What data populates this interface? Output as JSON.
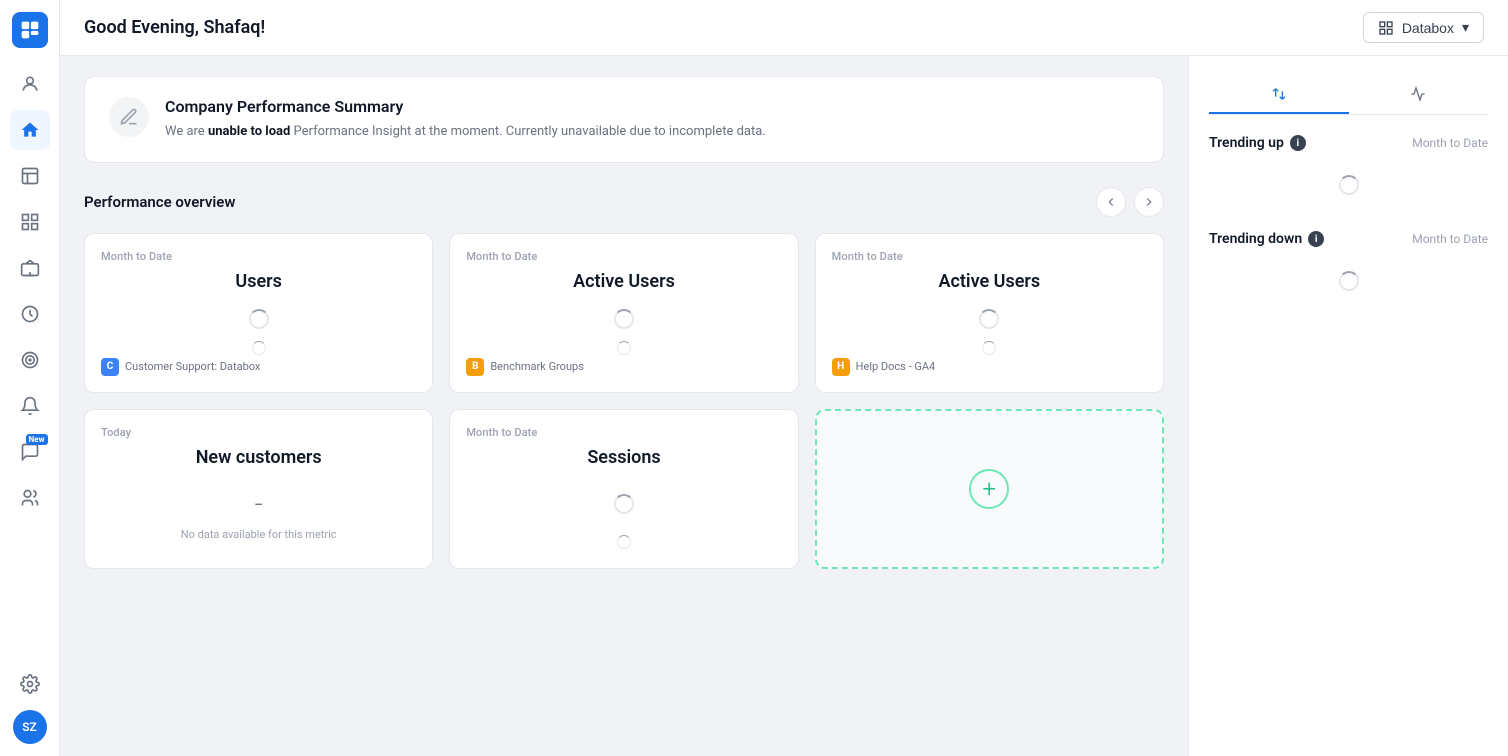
{
  "app": {
    "logo_label": "Databox logo"
  },
  "header": {
    "greeting": "Good Evening, Shafaq!",
    "databox_button": "Databox",
    "databox_arrow": "▾"
  },
  "sidebar": {
    "items": [
      {
        "name": "user-icon",
        "label": "User",
        "active": false
      },
      {
        "name": "home-icon",
        "label": "Home",
        "active": true
      },
      {
        "name": "scoreboard-icon",
        "label": "Scoreboard",
        "active": false
      },
      {
        "name": "dashboard-icon",
        "label": "Dashboard",
        "active": false
      },
      {
        "name": "tv-icon",
        "label": "TV",
        "active": false
      },
      {
        "name": "metrics-icon",
        "label": "Metrics",
        "active": false
      },
      {
        "name": "goals-icon",
        "label": "Goals",
        "active": false
      },
      {
        "name": "alerts-icon",
        "label": "Alerts",
        "active": false
      },
      {
        "name": "ask-icon",
        "label": "Ask",
        "active": false,
        "badge": "New"
      },
      {
        "name": "team-icon",
        "label": "Team",
        "active": false
      }
    ],
    "bottom_items": [
      {
        "name": "settings-icon",
        "label": "Settings"
      }
    ],
    "avatar": "SZ"
  },
  "company_summary": {
    "title": "Company Performance Summary",
    "text_prefix": "We are ",
    "text_bold": "unable to load",
    "text_suffix": " Performance Insight at the moment. Currently unavailable due to incomplete data."
  },
  "performance_overview": {
    "title": "Performance overview",
    "cards": [
      {
        "period": "Month to Date",
        "metric": "Users",
        "loading": true,
        "footer_label": "Customer Support: Databox",
        "footer_icon_type": "blue",
        "footer_icon_letter": "C"
      },
      {
        "period": "Month to Date",
        "metric": "Active Users",
        "loading": true,
        "footer_label": "Benchmark Groups",
        "footer_icon_type": "orange",
        "footer_icon_letter": "B"
      },
      {
        "period": "Month to Date",
        "metric": "Active Users",
        "loading": true,
        "footer_label": "Help Docs - GA4",
        "footer_icon_type": "orange",
        "footer_icon_letter": "H"
      },
      {
        "period": "Today",
        "metric": "New customers",
        "loading": false,
        "dash": "-",
        "no_data": "No data available for this metric",
        "footer_label": "",
        "footer_icon_type": ""
      },
      {
        "period": "Month to Date",
        "metric": "Sessions",
        "loading": true,
        "footer_label": "",
        "footer_icon_type": ""
      },
      {
        "type": "add",
        "label": "+"
      }
    ]
  },
  "right_panel": {
    "tabs": [
      {
        "label": "Trending up/down",
        "icon": "arrows-icon",
        "active": true
      },
      {
        "label": "Activity",
        "icon": "activity-icon",
        "active": false
      }
    ],
    "trending_up": {
      "label": "Trending up",
      "period": "Month to Date",
      "loading": true
    },
    "trending_down": {
      "label": "Trending down",
      "period": "Month to Date",
      "loading": true
    }
  }
}
